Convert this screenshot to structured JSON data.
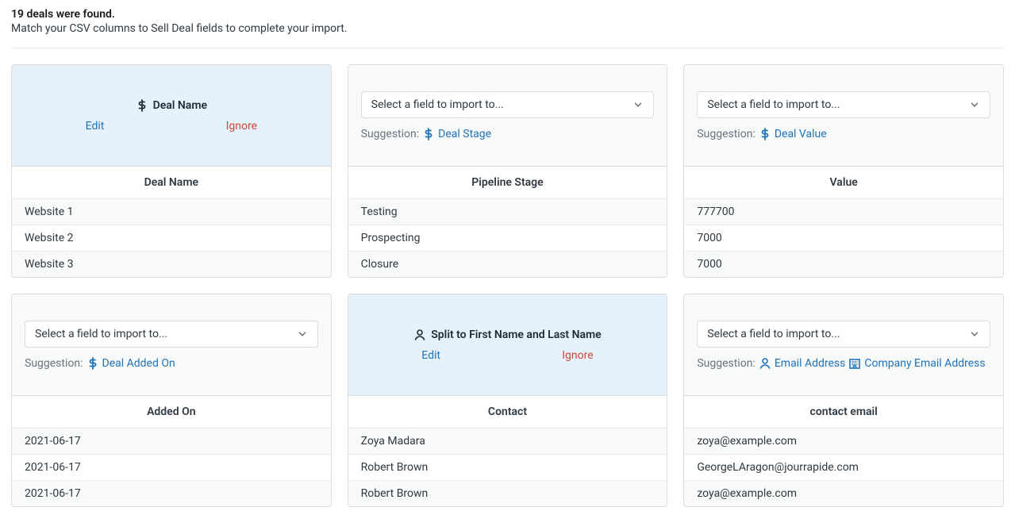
{
  "header": {
    "title": "19 deals were found.",
    "subtitle": "Match your CSV columns to Sell Deal fields to complete your import."
  },
  "select_placeholder": "Select a field to import to...",
  "suggestion_label": "Suggestion:",
  "actions": {
    "edit": "Edit",
    "ignore": "Ignore"
  },
  "cards": [
    {
      "mapped": true,
      "mapped_label": "Deal Name",
      "mapped_icon": "dollar",
      "column_header": "Deal Name",
      "rows": [
        "Website 1",
        "Website 2",
        "Website 3"
      ]
    },
    {
      "mapped": false,
      "suggestions": [
        {
          "icon": "dollar",
          "label": "Deal Stage"
        }
      ],
      "column_header": "Pipeline Stage",
      "rows": [
        "Testing",
        "Prospecting",
        "Closure"
      ]
    },
    {
      "mapped": false,
      "suggestions": [
        {
          "icon": "dollar",
          "label": "Deal Value"
        }
      ],
      "column_header": "Value",
      "rows": [
        "777700",
        "7000",
        "7000"
      ]
    },
    {
      "mapped": false,
      "suggestions": [
        {
          "icon": "dollar",
          "label": "Deal Added On"
        }
      ],
      "column_header": "Added On",
      "rows": [
        "2021-06-17",
        "2021-06-17",
        "2021-06-17"
      ]
    },
    {
      "mapped": true,
      "mapped_label": "Split to First Name and Last Name",
      "mapped_icon": "person",
      "column_header": "Contact",
      "rows": [
        "Zoya Madara",
        "Robert Brown",
        "Robert Brown"
      ]
    },
    {
      "mapped": false,
      "suggestions": [
        {
          "icon": "person",
          "label": "Email Address"
        },
        {
          "icon": "company",
          "label": "Company Email Address"
        }
      ],
      "column_header": "contact email",
      "rows": [
        "zoya@example.com",
        "GeorgeLAragon@jourrapide.com",
        "zoya@example.com"
      ]
    }
  ]
}
